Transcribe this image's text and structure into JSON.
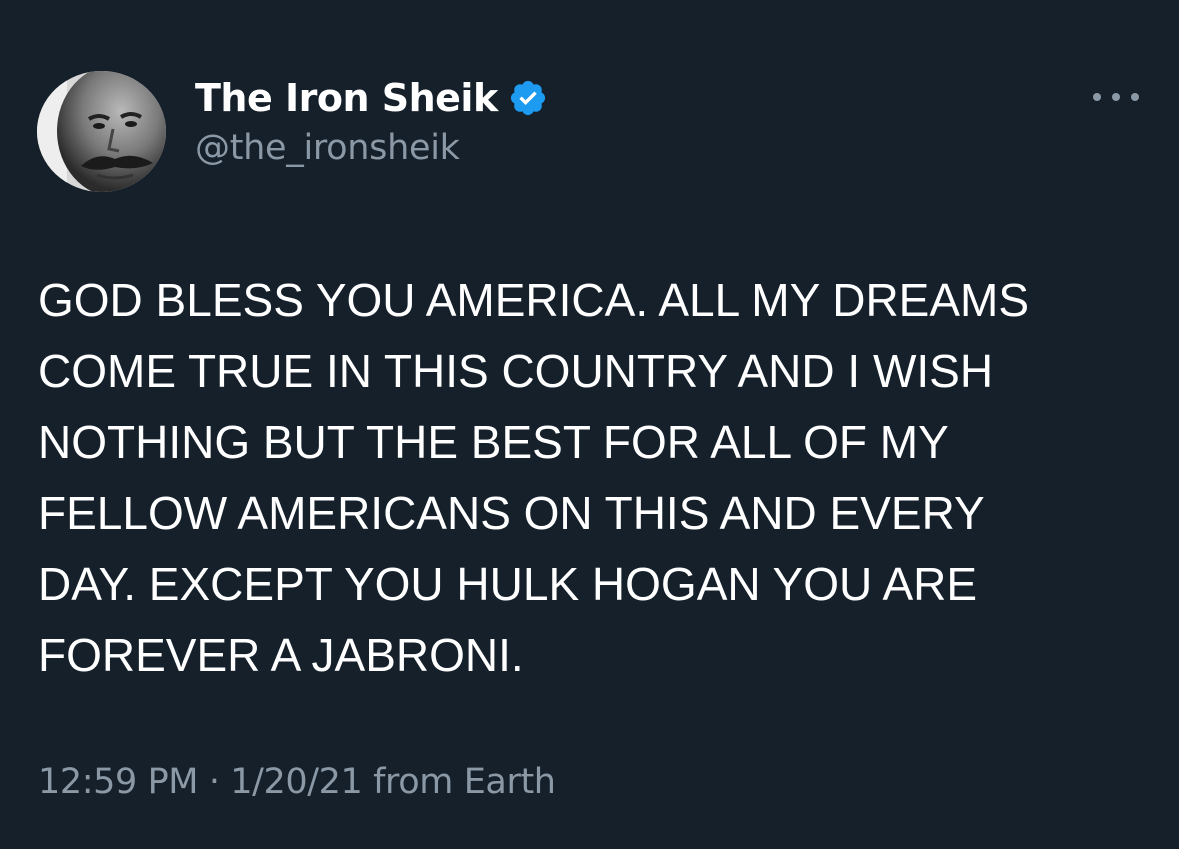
{
  "tweet": {
    "display_name": "The Iron Sheik",
    "handle": "@the_ironsheik",
    "verified_icon": "verified-badge-icon",
    "more_icon": "more-options-icon",
    "text": "GOD BLESS YOU AMERICA. ALL MY DREAMS\nCOME TRUE IN THIS COUNTRY AND I WISH\nNOTHING BUT THE BEST FOR ALL OF MY\nFELLOW AMERICANS ON THIS AND EVERY\nDAY. EXCEPT YOU HULK HOGAN YOU ARE\nFOREVER A JABRONI.",
    "timestamp": "12:59 PM · 1/20/21 from Earth"
  },
  "colors": {
    "background": "#15202b",
    "primary_text": "#ffffff",
    "secondary_text": "#8b98a5",
    "verified_blue": "#1d9bf0"
  }
}
